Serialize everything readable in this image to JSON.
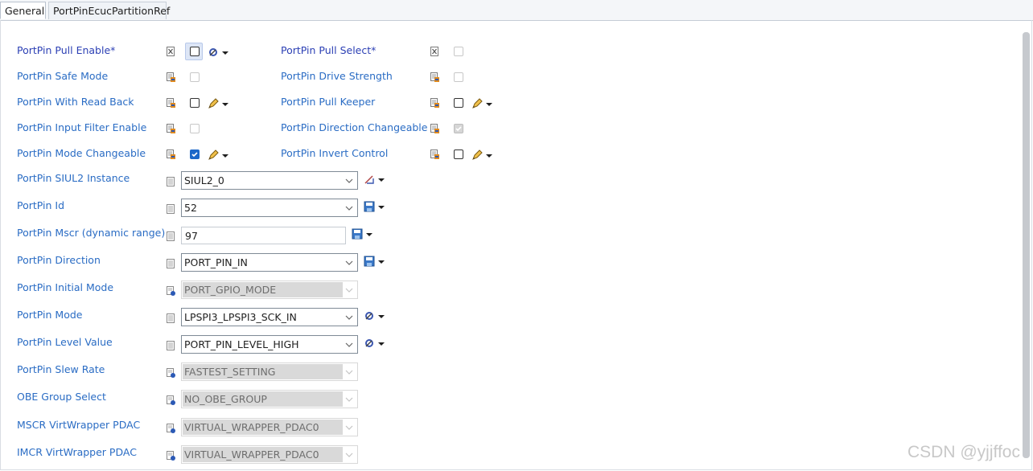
{
  "tabs": [
    {
      "label": "General",
      "active": true
    },
    {
      "label": "PortPinEcucPartitionRef",
      "active": false
    }
  ],
  "left_rows": [
    {
      "label": "PortPin Pull Enable*",
      "required": true,
      "checked": false,
      "disabled": false,
      "tool": "gear"
    },
    {
      "label": "PortPin Safe Mode",
      "required": false,
      "checked": false,
      "disabled": true,
      "tool": null
    },
    {
      "label": "PortPin With Read Back",
      "required": false,
      "checked": false,
      "disabled": false,
      "tool": "pencil"
    },
    {
      "label": "PortPin Input Filter Enable",
      "required": false,
      "checked": false,
      "disabled": true,
      "tool": null
    },
    {
      "label": "PortPin Mode Changeable",
      "required": false,
      "checked": true,
      "disabled": false,
      "tool": "pencil"
    }
  ],
  "right_rows": [
    {
      "label": "PortPin Pull Select*",
      "required": true,
      "checked": false,
      "disabled": true,
      "tool": null
    },
    {
      "label": "PortPin Drive Strength",
      "required": false,
      "checked": false,
      "disabled": true,
      "tool": null
    },
    {
      "label": "PortPin Pull Keeper",
      "required": false,
      "checked": false,
      "disabled": false,
      "tool": "pencil"
    },
    {
      "label": "PortPin Direction Changeable",
      "required": false,
      "checked": true,
      "disabled": true,
      "tool": null
    },
    {
      "label": "PortPin Invert Control",
      "required": false,
      "checked": false,
      "disabled": false,
      "tool": "pencil"
    }
  ],
  "fields": [
    {
      "label": "PortPin SIUL2 Instance",
      "value": "SIUL2_0",
      "kind": "combo",
      "disabled": false,
      "tool": "ref"
    },
    {
      "label": "PortPin Id",
      "value": "52",
      "kind": "combo",
      "disabled": false,
      "tool": "save"
    },
    {
      "label": "PortPin Mscr (dynamic range)",
      "value": "97",
      "kind": "text",
      "disabled": false,
      "tool": "save"
    },
    {
      "label": "PortPin Direction",
      "value": "PORT_PIN_IN",
      "kind": "combo",
      "disabled": false,
      "tool": "save"
    },
    {
      "label": "PortPin Initial Mode",
      "value": "PORT_GPIO_MODE",
      "kind": "combo",
      "disabled": true,
      "tool": null
    },
    {
      "label": "PortPin Mode",
      "value": "LPSPI3_LPSPI3_SCK_IN",
      "kind": "combo",
      "disabled": false,
      "tool": "gear"
    },
    {
      "label": "PortPin Level Value",
      "value": "PORT_PIN_LEVEL_HIGH",
      "kind": "combo",
      "disabled": false,
      "tool": "gear"
    },
    {
      "label": "PortPin Slew Rate",
      "value": "FASTEST_SETTING",
      "kind": "combo",
      "disabled": true,
      "tool": null
    },
    {
      "label": "OBE Group Select",
      "value": "NO_OBE_GROUP",
      "kind": "combo",
      "disabled": true,
      "tool": null
    },
    {
      "label": "MSCR VirtWrapper PDAC",
      "value": "VIRTUAL_WRAPPER_PDAC0",
      "kind": "combo",
      "disabled": true,
      "tool": null
    },
    {
      "label": "IMCR VirtWrapper PDAC",
      "value": "VIRTUAL_WRAPPER_PDAC0",
      "kind": "combo",
      "disabled": true,
      "tool": null
    }
  ],
  "watermark": "CSDN @yjjffoc",
  "colors": {
    "label": "#2a6cc4",
    "required_label": "#2b3fb4",
    "checked": "#1c68c9",
    "disabled_fill": "#d9d9d9"
  }
}
